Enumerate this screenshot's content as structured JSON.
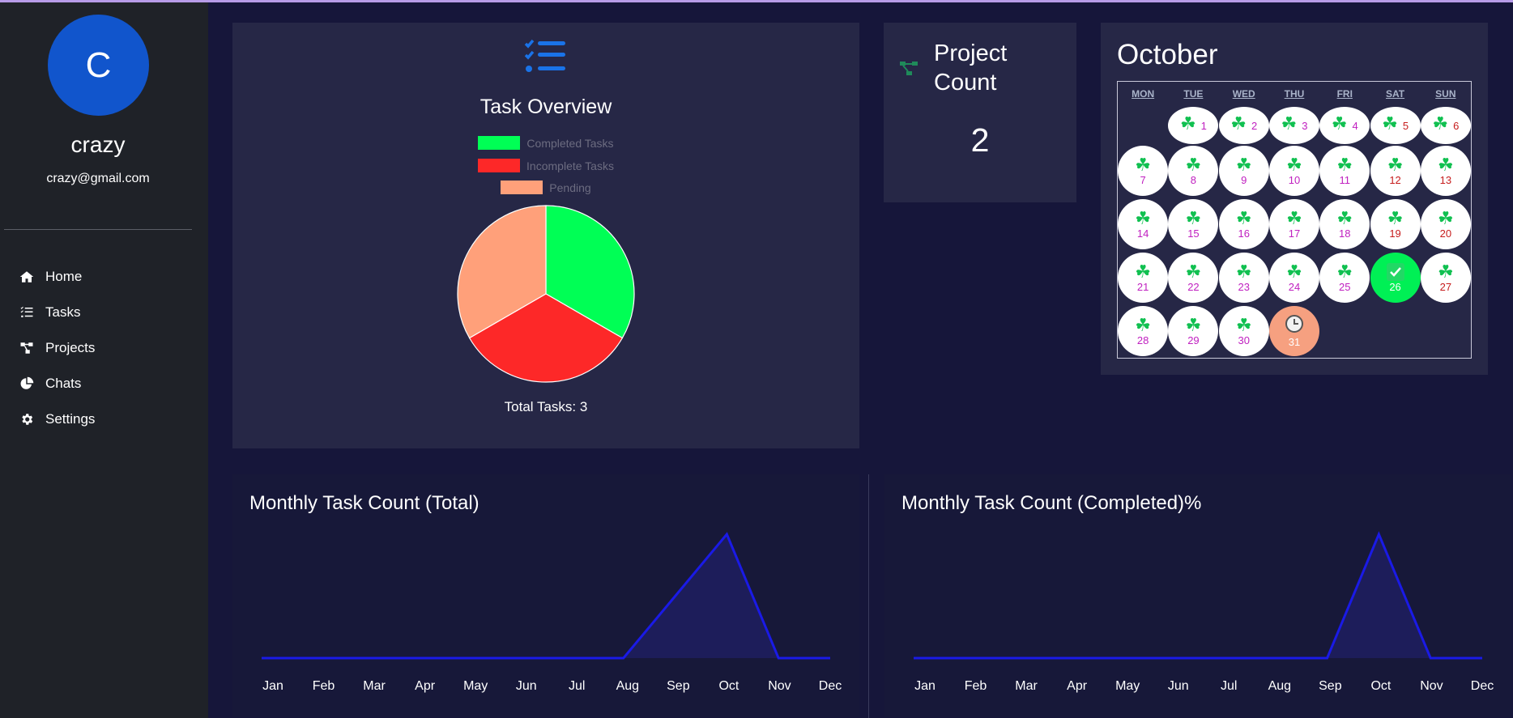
{
  "user": {
    "initial": "C",
    "name": "crazy",
    "email": "crazy@gmail.com"
  },
  "nav": [
    {
      "label": "Home",
      "icon": "home-icon"
    },
    {
      "label": "Tasks",
      "icon": "tasks-icon"
    },
    {
      "label": "Projects",
      "icon": "projects-icon"
    },
    {
      "label": "Chats",
      "icon": "chats-icon"
    },
    {
      "label": "Settings",
      "icon": "settings-icon"
    }
  ],
  "task_overview": {
    "title": "Task Overview",
    "total_label": "Total Tasks: 3",
    "legend": [
      {
        "label": "Completed Tasks",
        "color": "#00ff55"
      },
      {
        "label": "Incomplete Tasks",
        "color": "#fd2828"
      },
      {
        "label": "Pending",
        "color": "#ffa07a"
      }
    ]
  },
  "project_count": {
    "title": "Project Count",
    "value": "2"
  },
  "calendar": {
    "month": "October",
    "weekdays": [
      "MON",
      "TUE",
      "WED",
      "THU",
      "FRI",
      "SAT",
      "SUN"
    ],
    "days": [
      {
        "n": "1",
        "s": "clover"
      },
      {
        "n": "2",
        "s": "clover"
      },
      {
        "n": "3",
        "s": "clover"
      },
      {
        "n": "4",
        "s": "clover"
      },
      {
        "n": "5",
        "s": "clover"
      },
      {
        "n": "6",
        "s": "clover"
      },
      {
        "n": "7",
        "s": "clover"
      },
      {
        "n": "8",
        "s": "clover"
      },
      {
        "n": "9",
        "s": "clover"
      },
      {
        "n": "10",
        "s": "clover"
      },
      {
        "n": "11",
        "s": "clover"
      },
      {
        "n": "12",
        "s": "clover"
      },
      {
        "n": "13",
        "s": "clover"
      },
      {
        "n": "14",
        "s": "clover"
      },
      {
        "n": "15",
        "s": "clover"
      },
      {
        "n": "16",
        "s": "clover"
      },
      {
        "n": "17",
        "s": "clover"
      },
      {
        "n": "18",
        "s": "clover"
      },
      {
        "n": "19",
        "s": "clover"
      },
      {
        "n": "20",
        "s": "clover"
      },
      {
        "n": "21",
        "s": "clover"
      },
      {
        "n": "22",
        "s": "clover"
      },
      {
        "n": "23",
        "s": "clover"
      },
      {
        "n": "24",
        "s": "clover"
      },
      {
        "n": "25",
        "s": "clover"
      },
      {
        "n": "26",
        "s": "done"
      },
      {
        "n": "27",
        "s": "clover"
      },
      {
        "n": "28",
        "s": "clover"
      },
      {
        "n": "29",
        "s": "clover"
      },
      {
        "n": "30",
        "s": "clover"
      },
      {
        "n": "31",
        "s": "pending"
      }
    ]
  },
  "chart_data": [
    {
      "type": "pie",
      "labels": [
        "Completed Tasks",
        "Incomplete Tasks",
        "Pending"
      ],
      "values": [
        1,
        1,
        1
      ],
      "colors": [
        "#00ff55",
        "#fd2828",
        "#ffa07a"
      ]
    },
    {
      "type": "area",
      "title": "Monthly Task Count (Total)",
      "categories": [
        "Jan",
        "Feb",
        "Mar",
        "Apr",
        "May",
        "Jun",
        "Jul",
        "Aug",
        "Sep",
        "Oct",
        "Nov",
        "Dec"
      ],
      "values": [
        0,
        0,
        0,
        0,
        0,
        0,
        0,
        0,
        1.5,
        3,
        0,
        0
      ],
      "ylim": [
        0,
        3
      ],
      "color": "#1a1ae6"
    },
    {
      "type": "area",
      "title": "Monthly Task Count (Completed)%",
      "categories": [
        "Jan",
        "Feb",
        "Mar",
        "Apr",
        "May",
        "Jun",
        "Jul",
        "Aug",
        "Sep",
        "Oct",
        "Nov",
        "Dec"
      ],
      "values": [
        0,
        0,
        0,
        0,
        0,
        0,
        0,
        0,
        0,
        100,
        0,
        0
      ],
      "ylim": [
        0,
        100
      ],
      "color": "#1a1ae6"
    }
  ]
}
